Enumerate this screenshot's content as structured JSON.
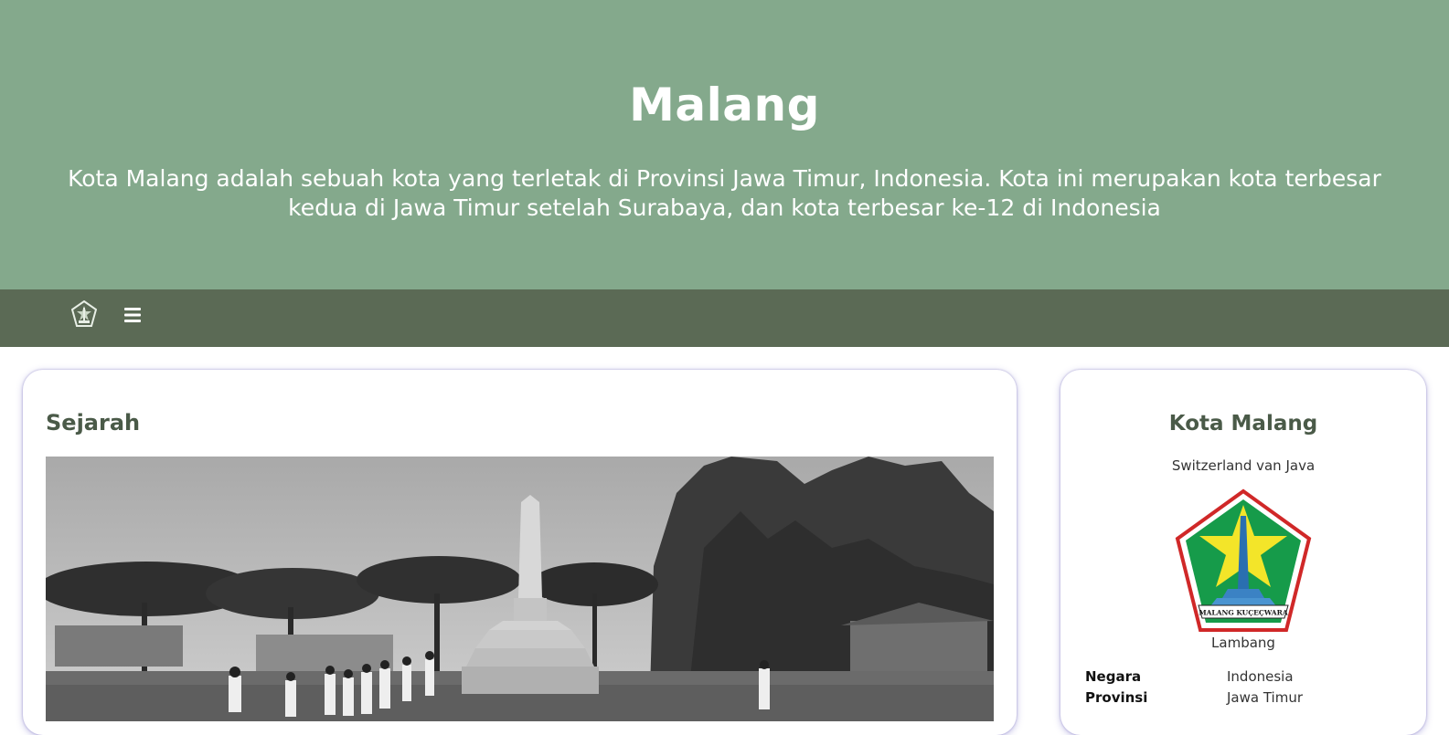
{
  "hero": {
    "title": "Malang",
    "description": "Kota Malang adalah sebuah kota yang terletak di Provinsi Jawa Timur, Indonesia. Kota ini merupakan kota terbesar kedua di Jawa Timur setelah Surabaya, dan kota terbesar ke-12 di Indonesia"
  },
  "navbar": {
    "logo_icon": "malang-emblem-icon",
    "menu_icon": "hamburger-menu-icon"
  },
  "main": {
    "section_title": "Sejarah",
    "image_icon": "historic-monument-photo"
  },
  "sidebar": {
    "title": "Kota Malang",
    "subtitle": "Switzerland van Java",
    "emblem_text": "MALANG KUÇEÇWARA",
    "emblem_caption": "Lambang",
    "info": [
      {
        "key": "Negara",
        "value": "Indonesia"
      },
      {
        "key": "Provinsi",
        "value": "Jawa Timur"
      }
    ]
  },
  "colors": {
    "hero_bg": "#84a98c",
    "navbar_bg": "#5b6a55",
    "heading": "#4a5a48"
  }
}
